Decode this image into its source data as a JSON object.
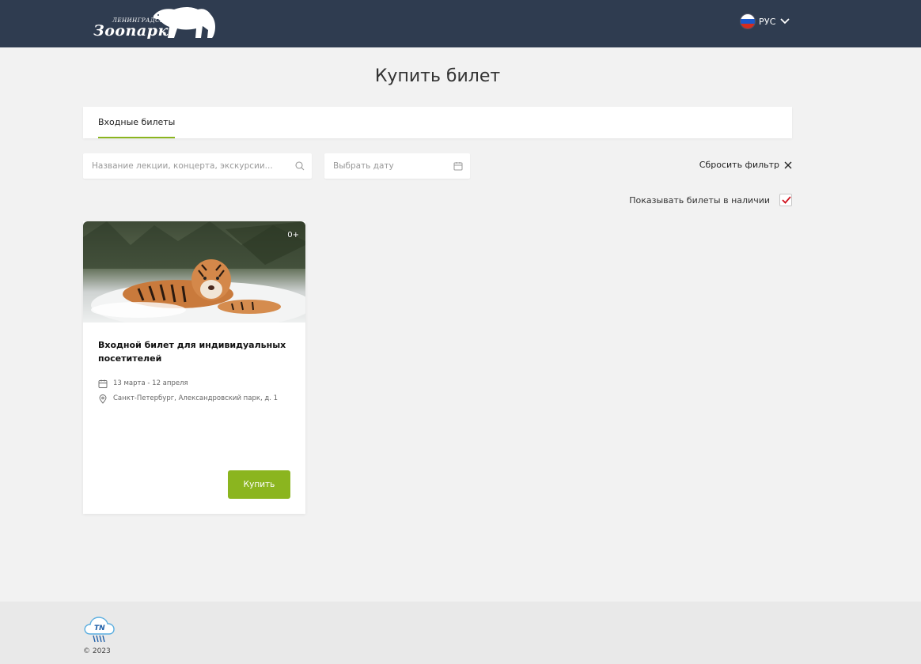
{
  "header": {
    "logo_small_text": "ЛЕНИНГРАДСКИЙ",
    "logo_big_text": "Зоопарк",
    "language": "РУС",
    "flag_icon": "russia-flag-icon",
    "chevron_icon": "chevron-down-icon"
  },
  "page": {
    "title": "Купить билет"
  },
  "tabs": [
    {
      "label": "Входные билеты",
      "active": true
    }
  ],
  "filters": {
    "search_placeholder": "Название лекции, концерта, экскурсии...",
    "search_icon": "search-icon",
    "date_placeholder": "Выбрать дату",
    "date_icon": "calendar-icon",
    "reset_label": "Сбросить фильтр",
    "reset_icon": "close-icon",
    "instock_label": "Показывать билеты в наличии",
    "instock_checked": true
  },
  "cards": [
    {
      "age_rating": "0+",
      "image": "tiger-in-snow",
      "title": "Входной билет для индивидуальных посетителей",
      "dates": "13 марта - 12 апреля",
      "location": "Санкт-Петербург, Александровский парк, д. 1",
      "buy_label": "Купить"
    }
  ],
  "footer": {
    "copyright": "© 2023",
    "logo_text": "TN"
  },
  "colors": {
    "header_bg": "#2f3c50",
    "accent": "#8bb51f",
    "page_bg": "#f2f2f2"
  }
}
